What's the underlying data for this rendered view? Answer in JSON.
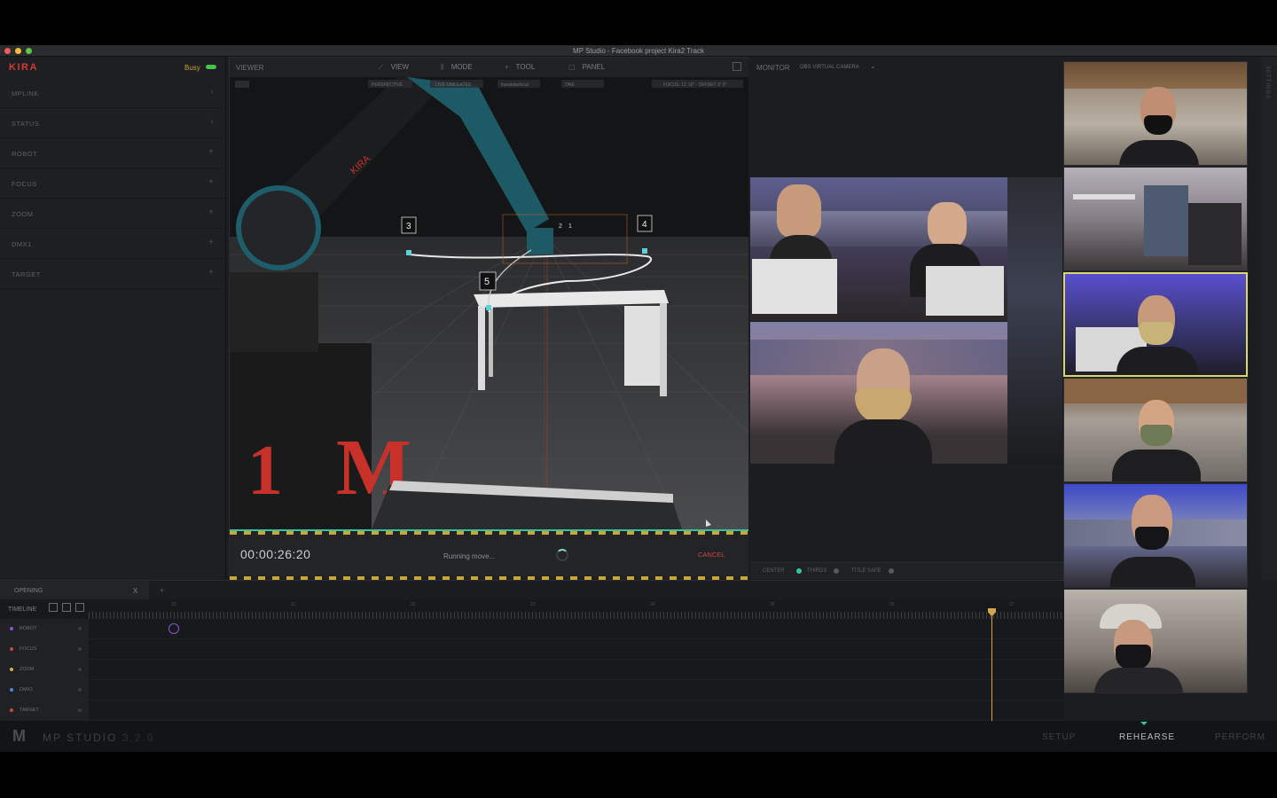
{
  "window": {
    "title": "MP Studio - Facebook project Kira2 Track"
  },
  "sidebar": {
    "logo": "KIRA",
    "status": "Busy",
    "items": [
      {
        "label": "MPLINK",
        "icon": "chevron-left-icon",
        "glyph": "‹"
      },
      {
        "label": "STATUS",
        "icon": "chevron-left-icon",
        "glyph": "‹"
      },
      {
        "label": "ROBOT",
        "icon": "plus-icon",
        "glyph": "+"
      },
      {
        "label": "FOCUS",
        "icon": "plus-icon",
        "glyph": "+"
      },
      {
        "label": "ZOOM",
        "icon": "plus-icon",
        "glyph": "+"
      },
      {
        "label": "DMX1",
        "icon": "plus-icon",
        "glyph": "+"
      },
      {
        "label": "TARGET",
        "icon": "plus-icon",
        "glyph": "+"
      }
    ]
  },
  "viewer": {
    "title": "VIEWER",
    "buttons": {
      "view": "VIEW",
      "mode": "MODE",
      "tool": "TOOL",
      "panel": "PANEL"
    },
    "scene_tags": {
      "perspective": "PERSPECTIVE",
      "live": "LIVE SIMULATED",
      "translate": "translate/local",
      "one": "ONE",
      "focus": "FOCUS: 11' 10\" - OFFSET: 0' 0\""
    },
    "robot_brand": "KIRA",
    "waypoints": [
      "3",
      "4",
      "5",
      "2",
      "1"
    ],
    "timecode": "00:00:26:20",
    "running": "Running move...",
    "cancel": "CANCEL"
  },
  "monitor": {
    "title": "MONITOR",
    "camera": "OBS VIRTUAL CAMERA",
    "footer": {
      "center": "CENTER",
      "thirds": "THIRDS",
      "title_safe": "TITLE SAFE"
    }
  },
  "timeline": {
    "tab": "OPENING",
    "tab_close": "X",
    "add": "+",
    "label": "TIMELINE",
    "ruler": [
      "22",
      "21",
      "22",
      "23",
      "24",
      "25",
      "26",
      "27"
    ],
    "tracks": [
      {
        "label": "ROBOT",
        "color": "#8a56d1"
      },
      {
        "label": "FOCUS",
        "color": "#d0453a"
      },
      {
        "label": "ZOOM",
        "color": "#d9b23a"
      },
      {
        "label": "DMX1",
        "color": "#4a8ad9"
      },
      {
        "label": "TARGET",
        "color": "#d0453a"
      }
    ]
  },
  "footer": {
    "logo": "M",
    "app_name": "MP STUDIO",
    "version": "3.2.0",
    "modes": [
      "SETUP",
      "REHEARSE",
      "PERFORM"
    ],
    "active_mode": "REHEARSE"
  },
  "settings_label": "SETTINGS"
}
